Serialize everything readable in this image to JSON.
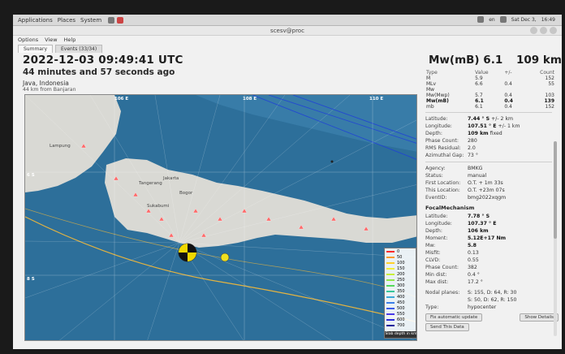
{
  "system": {
    "menus": [
      "Applications",
      "Places",
      "System"
    ],
    "tray_lang": "en",
    "tray_date": "Sat Dec 3,",
    "tray_time": "16:49"
  },
  "window": {
    "title": "scesv@proc"
  },
  "menu": [
    "Options",
    "View",
    "Help"
  ],
  "tabs": [
    "Summary",
    "Events (33/34)"
  ],
  "event": {
    "datetime": "2022-12-03 09:49:41 UTC",
    "ago": "44 minutes and 57 seconds ago",
    "region": "Java, Indonesia",
    "nearest": "44 km from Banjaran",
    "magnitude_title": "Mw(mB) 6.1",
    "depth_title": "109 km"
  },
  "mag_table": {
    "headers": [
      "Type",
      "Value",
      "+/-",
      "Count"
    ],
    "rows": [
      [
        "M",
        "5.9",
        "",
        "152"
      ],
      [
        "MLv",
        "6.6",
        "0.4",
        "55"
      ],
      [
        "Mw",
        "",
        "",
        ""
      ],
      [
        "Mw(Mwp)",
        "5.7",
        "0.4",
        "103"
      ],
      [
        "Mw(mB)",
        "6.1",
        "0.4",
        "139"
      ],
      [
        "mb",
        "6.1",
        "0.4",
        "152"
      ]
    ]
  },
  "origin": {
    "latitude_label": "Latitude:",
    "latitude": "7.44 ° S",
    "latitude_err": "+/-   2 km",
    "longitude_label": "Longitude:",
    "longitude": "107.51 ° E",
    "longitude_err": "+/-   1 km",
    "depth_label": "Depth:",
    "depth": "109 km",
    "depth_note": "fixed",
    "phase_label": "Phase Count:",
    "phase": "280",
    "rms_label": "RMS Residual:",
    "rms": "2.0",
    "gap_label": "Azimuthal Gap:",
    "gap": "73 °"
  },
  "info": {
    "agency_label": "Agency:",
    "agency": "BMKG",
    "status_label": "Status:",
    "status": "manual",
    "first_label": "First Location:",
    "first": "O.T. + 1m 33s",
    "this_label": "This Location:",
    "this": "O.T. +23m 07s",
    "eventid_label": "EventID:",
    "eventid": "bmg2022xqgm"
  },
  "focal": {
    "title": "FocalMechanism",
    "latitude_label": "Latitude:",
    "latitude": "7.78 ° S",
    "longitude_label": "Longitude:",
    "longitude": "107.37 ° E",
    "depth_label": "Depth:",
    "depth": "106 km",
    "moment_label": "Moment:",
    "moment": "5.12E+17 Nm",
    "mw_label": "Mw:",
    "mw": "5.8",
    "misfit_label": "Misfit:",
    "misfit": "0.13",
    "clvd_label": "CLVD:",
    "clvd": "0.55",
    "phase_label": "Phase Count:",
    "phase": "382",
    "mindist_label": "Min dist:",
    "mindist": "0.4 °",
    "maxdist_label": "Max dist:",
    "maxdist": "17.2 °",
    "nodal_label": "Nodal planes:",
    "nodal1": "S: 155, D: 64, R: 30",
    "nodal2": "S: 50, D: 62, R: 150",
    "type_label": "Type:",
    "type": "hypocenter"
  },
  "buttons": {
    "auto_update": "Fix automatic update",
    "show_details": "Show Details",
    "send": "Send This Data"
  },
  "map": {
    "lon_labels": [
      "106 E",
      "108 E",
      "110 E"
    ],
    "lat_labels": [
      "6 S",
      "8 S"
    ],
    "places": [
      "Lampung",
      "Tangerang",
      "Jakarta",
      "Bogor",
      "Sukabumi"
    ],
    "legend_values": [
      "0",
      "50",
      "100",
      "150",
      "200",
      "250",
      "300",
      "350",
      "400",
      "450",
      "500",
      "550",
      "600",
      "700"
    ],
    "legend_colors": [
      "#ff2a2a",
      "#ff9a2a",
      "#ffd12a",
      "#f3ee3a",
      "#c8ef3a",
      "#8fe84a",
      "#54d95c",
      "#38c79a",
      "#3aa9d9",
      "#3a7fe8",
      "#3a5ae8",
      "#4a3ae8",
      "#2a2ad9",
      "#1a1a9a"
    ],
    "legend_caption": "Slab depth in km",
    "ocean_color": "#2d6f9a",
    "land_color": "#d9d9d4"
  }
}
